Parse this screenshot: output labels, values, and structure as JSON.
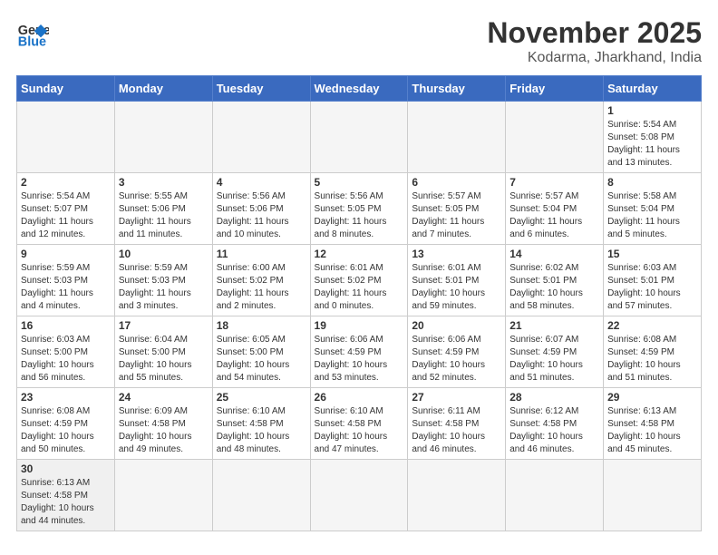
{
  "header": {
    "logo_general": "General",
    "logo_blue": "Blue",
    "month_title": "November 2025",
    "location": "Kodarma, Jharkhand, India"
  },
  "weekdays": [
    "Sunday",
    "Monday",
    "Tuesday",
    "Wednesday",
    "Thursday",
    "Friday",
    "Saturday"
  ],
  "weeks": [
    [
      {
        "day": "",
        "info": ""
      },
      {
        "day": "",
        "info": ""
      },
      {
        "day": "",
        "info": ""
      },
      {
        "day": "",
        "info": ""
      },
      {
        "day": "",
        "info": ""
      },
      {
        "day": "",
        "info": ""
      },
      {
        "day": "1",
        "info": "Sunrise: 5:54 AM\nSunset: 5:08 PM\nDaylight: 11 hours\nand 13 minutes."
      }
    ],
    [
      {
        "day": "2",
        "info": "Sunrise: 5:54 AM\nSunset: 5:07 PM\nDaylight: 11 hours\nand 12 minutes."
      },
      {
        "day": "3",
        "info": "Sunrise: 5:55 AM\nSunset: 5:06 PM\nDaylight: 11 hours\nand 11 minutes."
      },
      {
        "day": "4",
        "info": "Sunrise: 5:56 AM\nSunset: 5:06 PM\nDaylight: 11 hours\nand 10 minutes."
      },
      {
        "day": "5",
        "info": "Sunrise: 5:56 AM\nSunset: 5:05 PM\nDaylight: 11 hours\nand 8 minutes."
      },
      {
        "day": "6",
        "info": "Sunrise: 5:57 AM\nSunset: 5:05 PM\nDaylight: 11 hours\nand 7 minutes."
      },
      {
        "day": "7",
        "info": "Sunrise: 5:57 AM\nSunset: 5:04 PM\nDaylight: 11 hours\nand 6 minutes."
      },
      {
        "day": "8",
        "info": "Sunrise: 5:58 AM\nSunset: 5:04 PM\nDaylight: 11 hours\nand 5 minutes."
      }
    ],
    [
      {
        "day": "9",
        "info": "Sunrise: 5:59 AM\nSunset: 5:03 PM\nDaylight: 11 hours\nand 4 minutes."
      },
      {
        "day": "10",
        "info": "Sunrise: 5:59 AM\nSunset: 5:03 PM\nDaylight: 11 hours\nand 3 minutes."
      },
      {
        "day": "11",
        "info": "Sunrise: 6:00 AM\nSunset: 5:02 PM\nDaylight: 11 hours\nand 2 minutes."
      },
      {
        "day": "12",
        "info": "Sunrise: 6:01 AM\nSunset: 5:02 PM\nDaylight: 11 hours\nand 0 minutes."
      },
      {
        "day": "13",
        "info": "Sunrise: 6:01 AM\nSunset: 5:01 PM\nDaylight: 10 hours\nand 59 minutes."
      },
      {
        "day": "14",
        "info": "Sunrise: 6:02 AM\nSunset: 5:01 PM\nDaylight: 10 hours\nand 58 minutes."
      },
      {
        "day": "15",
        "info": "Sunrise: 6:03 AM\nSunset: 5:01 PM\nDaylight: 10 hours\nand 57 minutes."
      }
    ],
    [
      {
        "day": "16",
        "info": "Sunrise: 6:03 AM\nSunset: 5:00 PM\nDaylight: 10 hours\nand 56 minutes."
      },
      {
        "day": "17",
        "info": "Sunrise: 6:04 AM\nSunset: 5:00 PM\nDaylight: 10 hours\nand 55 minutes."
      },
      {
        "day": "18",
        "info": "Sunrise: 6:05 AM\nSunset: 5:00 PM\nDaylight: 10 hours\nand 54 minutes."
      },
      {
        "day": "19",
        "info": "Sunrise: 6:06 AM\nSunset: 4:59 PM\nDaylight: 10 hours\nand 53 minutes."
      },
      {
        "day": "20",
        "info": "Sunrise: 6:06 AM\nSunset: 4:59 PM\nDaylight: 10 hours\nand 52 minutes."
      },
      {
        "day": "21",
        "info": "Sunrise: 6:07 AM\nSunset: 4:59 PM\nDaylight: 10 hours\nand 51 minutes."
      },
      {
        "day": "22",
        "info": "Sunrise: 6:08 AM\nSunset: 4:59 PM\nDaylight: 10 hours\nand 51 minutes."
      }
    ],
    [
      {
        "day": "23",
        "info": "Sunrise: 6:08 AM\nSunset: 4:59 PM\nDaylight: 10 hours\nand 50 minutes."
      },
      {
        "day": "24",
        "info": "Sunrise: 6:09 AM\nSunset: 4:58 PM\nDaylight: 10 hours\nand 49 minutes."
      },
      {
        "day": "25",
        "info": "Sunrise: 6:10 AM\nSunset: 4:58 PM\nDaylight: 10 hours\nand 48 minutes."
      },
      {
        "day": "26",
        "info": "Sunrise: 6:10 AM\nSunset: 4:58 PM\nDaylight: 10 hours\nand 47 minutes."
      },
      {
        "day": "27",
        "info": "Sunrise: 6:11 AM\nSunset: 4:58 PM\nDaylight: 10 hours\nand 46 minutes."
      },
      {
        "day": "28",
        "info": "Sunrise: 6:12 AM\nSunset: 4:58 PM\nDaylight: 10 hours\nand 46 minutes."
      },
      {
        "day": "29",
        "info": "Sunrise: 6:13 AM\nSunset: 4:58 PM\nDaylight: 10 hours\nand 45 minutes."
      }
    ],
    [
      {
        "day": "30",
        "info": "Sunrise: 6:13 AM\nSunset: 4:58 PM\nDaylight: 10 hours\nand 44 minutes."
      },
      {
        "day": "",
        "info": ""
      },
      {
        "day": "",
        "info": ""
      },
      {
        "day": "",
        "info": ""
      },
      {
        "day": "",
        "info": ""
      },
      {
        "day": "",
        "info": ""
      },
      {
        "day": "",
        "info": ""
      }
    ]
  ]
}
